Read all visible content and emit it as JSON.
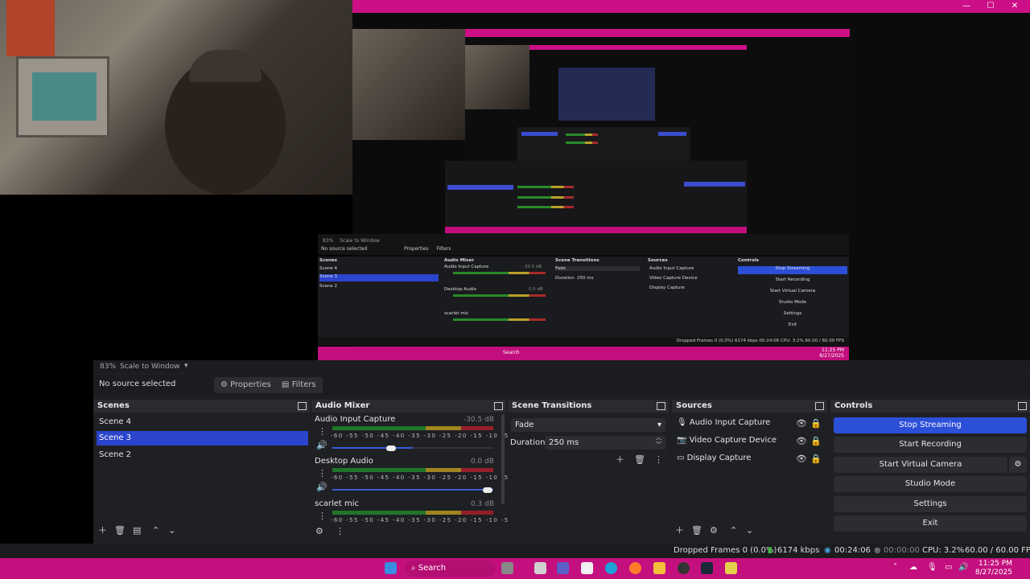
{
  "window": {
    "title_buttons": [
      "minimize-icon",
      "maximize-icon",
      "close-icon"
    ]
  },
  "preview": {
    "zoom": "83%",
    "scale_mode": "Scale to Window",
    "nested": {
      "no_source": "No source selected",
      "properties": "Properties",
      "filters": "Filters",
      "scenes_title": "Scenes",
      "scenes": [
        "Scene 4",
        "Scene 3",
        "Scene 2"
      ],
      "mixer_title": "Audio Mixer",
      "mixer_items": [
        {
          "label": "Audio Input Capture",
          "db": "-30.5 dB"
        },
        {
          "label": "Desktop Audio",
          "db": "0.0 dB"
        },
        {
          "label": "scarlet mic",
          "db": ""
        }
      ],
      "transitions_title": "Scene Transitions",
      "transition": "Fade",
      "duration_label": "Duration",
      "duration_value": "250 ms",
      "sources_title": "Sources",
      "sources": [
        "Audio Input Capture",
        "Video Capture Device",
        "Display Capture"
      ],
      "controls_title": "Controls",
      "controls": [
        "Stop Streaming",
        "Start Recording",
        "Start Virtual Camera",
        "Studio Mode",
        "Settings",
        "Exit"
      ],
      "status": "Dropped Frames 0 (0.0%)  6174 kbps  00:24:06  CPU: 3.2%  60.00 / 60.00 FPS",
      "search": "Search",
      "clock_time": "11:25 PM",
      "clock_date": "8/27/2025"
    }
  },
  "source_bar": {
    "no_source": "No source selected",
    "properties": "Properties",
    "filters": "Filters"
  },
  "scenes": {
    "title": "Scenes",
    "items": [
      {
        "label": "Scene 4",
        "selected": false
      },
      {
        "label": "Scene 3",
        "selected": true
      },
      {
        "label": "Scene 2",
        "selected": false
      }
    ]
  },
  "mixer": {
    "title": "Audio Mixer",
    "ticks": "-60 -55 -50 -45 -40 -35 -30 -25 -20 -15 -10 -5 0",
    "channels": [
      {
        "label": "Audio Input Capture",
        "db": "-30.5 dB",
        "level": 0.5,
        "volume": 0.55
      },
      {
        "label": "Desktop Audio",
        "db": "0.0 dB",
        "level": 0.0,
        "volume": 1.0
      },
      {
        "label": "scarlet mic",
        "db": "0.3 dB",
        "level": 0.0,
        "volume": 1.0
      }
    ]
  },
  "transitions": {
    "title": "Scene Transitions",
    "selected": "Fade",
    "duration_label": "Duration",
    "duration_value": "250 ms"
  },
  "sources": {
    "title": "Sources",
    "items": [
      {
        "label": "Audio Input Capture",
        "icon": "microphone-icon"
      },
      {
        "label": "Video Capture Device",
        "icon": "camera-icon"
      },
      {
        "label": "Display Capture",
        "icon": "monitor-icon"
      }
    ]
  },
  "controls": {
    "title": "Controls",
    "stop_streaming": "Stop Streaming",
    "start_recording": "Start Recording",
    "start_virtual_camera": "Start Virtual Camera",
    "studio_mode": "Studio Mode",
    "settings": "Settings",
    "exit": "Exit"
  },
  "status": {
    "dropped": "Dropped Frames 0 (0.0%)",
    "bitrate": "6174 kbps",
    "stream_time": "00:24:06",
    "record_time": "00:00:00",
    "cpu": "CPU: 3.2%",
    "fps": "60.00 / 60.00 FPS"
  },
  "taskbar": {
    "search": "Search",
    "time": "11:25 PM",
    "date": "8/27/2025"
  },
  "colors": {
    "accent": "#cc0f86",
    "selection": "#2b45cc",
    "taskbar": "#c4107e"
  }
}
